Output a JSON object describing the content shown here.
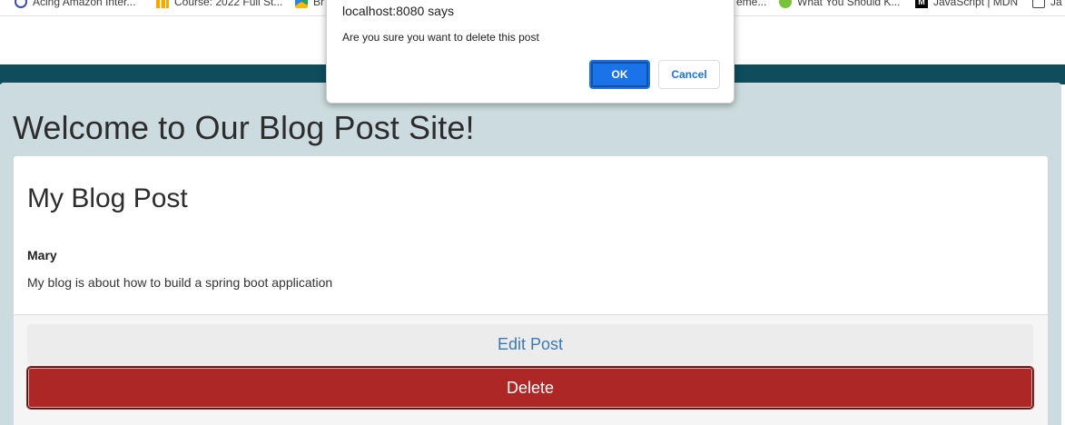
{
  "bookmarks": [
    {
      "label": "Acing Amazon Inter...",
      "icon": "globe-icon"
    },
    {
      "label": "Course: 2022 Full St...",
      "icon": "bars-icon"
    },
    {
      "label": "Br",
      "icon": "drive-icon"
    },
    {
      "label": "eme...",
      "icon": ""
    },
    {
      "label": "What You Should K...",
      "icon": "green-dot-icon"
    },
    {
      "label": "JavaScript | MDN",
      "icon": "mdn-icon"
    },
    {
      "label": "Ja",
      "icon": "doc-icon"
    }
  ],
  "page": {
    "site_title": "Welcome to Our Blog Post Site!"
  },
  "post": {
    "title": "My Blog Post",
    "author": "Mary",
    "body": "My blog is about how to build a spring boot application",
    "edit_label": "Edit Post",
    "delete_label": "Delete"
  },
  "dialog": {
    "title": "localhost:8080 says",
    "message": "Are you sure you want to delete this post",
    "ok_label": "OK",
    "cancel_label": "Cancel"
  },
  "colors": {
    "header": "#0f4d5c",
    "page_bg": "#ccdbdf",
    "delete_bg": "#ad2726",
    "edit_text": "#3a79b3",
    "dialog_ok": "#1a73e8"
  }
}
